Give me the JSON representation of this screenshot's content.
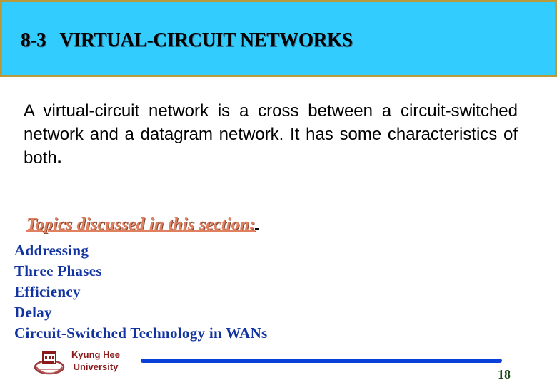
{
  "slide": {
    "title": "8-3   VIRTUAL-CIRCUIT NETWORKS",
    "intro_text": "A virtual-circuit network is a cross between a circuit-switched network and a datagram network. It has some characteristics of both",
    "intro_period": ".",
    "topics_heading": "Topics discussed in this section:",
    "topics": [
      "Addressing",
      "Three Phases",
      "Efficiency",
      "Delay",
      "Circuit-Switched Technology in WANs"
    ]
  },
  "footer": {
    "logo_icon": "university-emblem-icon",
    "university_line1": "Kyung Hee",
    "university_line2": "University",
    "page_number": "18"
  },
  "colors": {
    "title_background": "#33ccff",
    "title_border": "#b89a3a",
    "topics_heading": "#e0805e",
    "topics_list": "#1234a0",
    "footer_line": "#0a3fd9",
    "university_text": "#8b1a1a",
    "page_number": "#1a4a1a"
  }
}
